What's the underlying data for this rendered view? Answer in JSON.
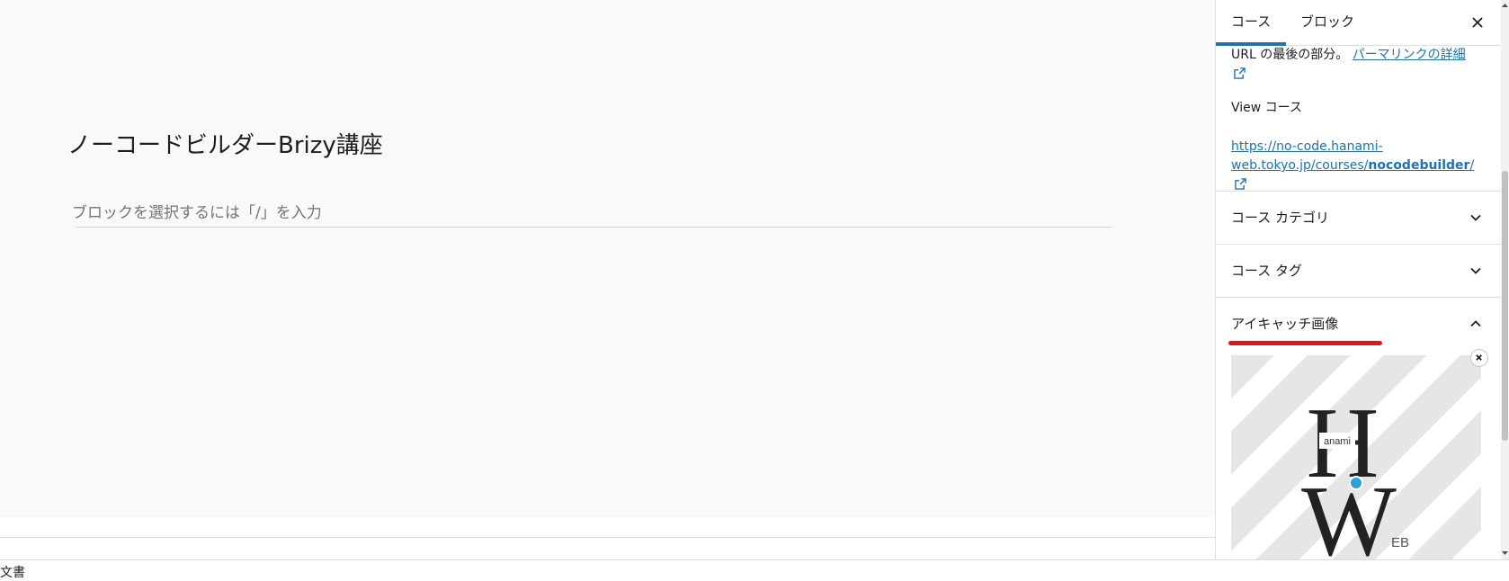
{
  "editor": {
    "post_title": "ノーコードビルダーBrizy講座",
    "block_placeholder": "ブロックを選択するには「/」を入力"
  },
  "status_bar": {
    "text": "文書"
  },
  "sidebar": {
    "tabs": [
      {
        "label": "コース",
        "active": true
      },
      {
        "label": "ブロック",
        "active": false
      }
    ],
    "url_help_prefix": "URL の最後の部分。",
    "url_help_link": "パーマリンクの詳細",
    "view_label": "View コース",
    "permalink_base": "https://no-code.hanami-web.tokyo.jp/courses/",
    "permalink_slug": "nocodebuilder",
    "permalink_suffix": "/",
    "panels": [
      {
        "title": "コース カテゴリ",
        "expanded": false
      },
      {
        "title": "コース タグ",
        "expanded": false
      },
      {
        "title": "アイキャッチ画像",
        "expanded": true
      }
    ],
    "featured_image": {
      "logo_text_small": "anami",
      "logo_letter_top": "H",
      "logo_letter_bottom": "W",
      "logo_text_bottom": "EB"
    }
  },
  "colors": {
    "accent": "#2271b1",
    "annotation_red": "#e1161a",
    "logo_dot": "#2aa4d5"
  },
  "icons": [
    "close-icon",
    "external-link-icon",
    "chevron-down-icon",
    "chevron-up-icon",
    "remove-image-icon"
  ]
}
